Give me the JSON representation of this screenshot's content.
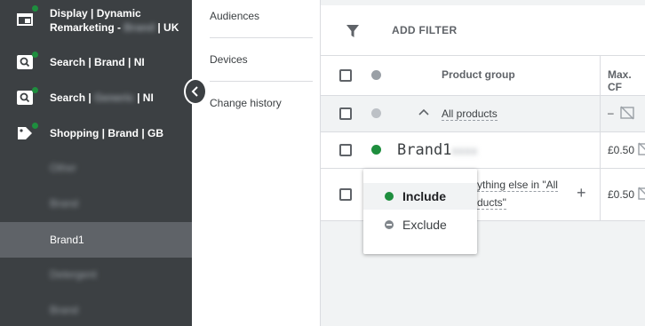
{
  "sidebar": {
    "campaigns": [
      {
        "line1": "Display | Dynamic",
        "line2_pre": "Remarketing - ",
        "line2_blur": "Brand",
        "line2_post": " | UK",
        "icon": "display-icon"
      },
      {
        "label": "Search | Brand | NI",
        "icon": "search-icon"
      },
      {
        "label_pre": "Search | ",
        "label_blur": "Generic",
        "label_post": " | NI",
        "icon": "search-icon"
      },
      {
        "label": "Shopping | Brand | GB",
        "icon": "tag-icon"
      }
    ],
    "adgroups": [
      {
        "label": "Other",
        "blurred": true
      },
      {
        "label": "Brand",
        "blurred": true
      },
      {
        "label": "Brand1",
        "blurred": false,
        "selected": true
      },
      {
        "label": "Detergent",
        "blurred": true
      },
      {
        "label": "Brand",
        "blurred": true
      }
    ],
    "status_color": "#1e8e3e"
  },
  "subnav": {
    "links": [
      "Audiences",
      "Devices",
      "Change history"
    ]
  },
  "table": {
    "add_filter": "ADD FILTER",
    "header": {
      "product_group": "Product group",
      "max_cpc": "Max. CF"
    },
    "all_products": {
      "label": "All products",
      "max_cpc": "–"
    },
    "brand_row": {
      "label": "Brand1",
      "label_blur": "xxxx",
      "max_cpc": "£0.50"
    },
    "everything_row": {
      "line1": "ything else in \"All",
      "line2": "ducts\"",
      "max_cpc": "£0.50",
      "add": "+"
    }
  },
  "menu": {
    "include": "Include",
    "exclude": "Exclude",
    "include_color": "#1e8e3e",
    "exclude_color": "#80868b"
  }
}
